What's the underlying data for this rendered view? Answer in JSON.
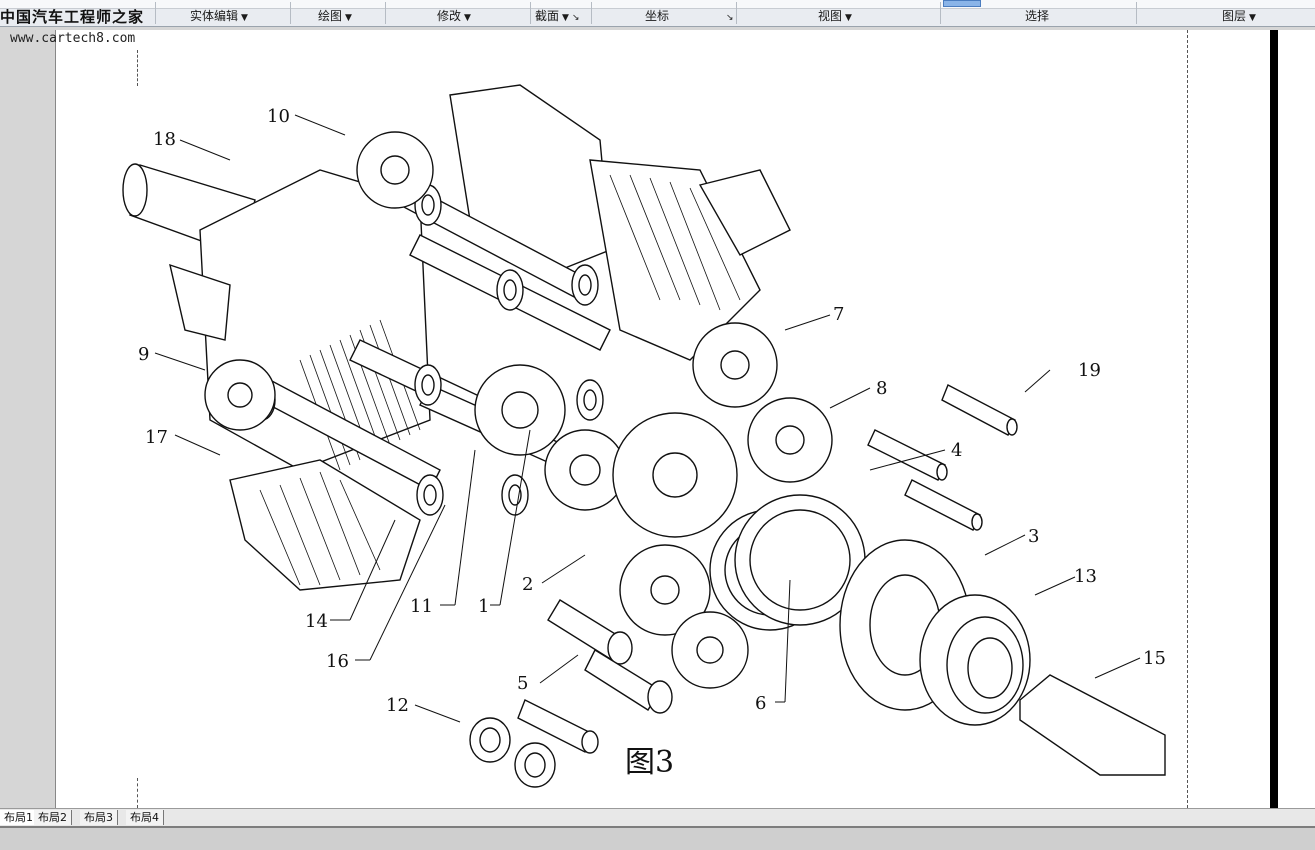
{
  "watermark": {
    "logo": "中国汽车工程师之家",
    "url": "www.cartech8.com"
  },
  "ribbon": {
    "panels": [
      {
        "label": "实体编辑"
      },
      {
        "label": "绘图"
      },
      {
        "label": "修改"
      },
      {
        "label": "截面"
      },
      {
        "label": "坐标"
      },
      {
        "label": "视图"
      },
      {
        "label": "选择"
      },
      {
        "label": "图层"
      }
    ]
  },
  "drawing": {
    "figure_caption": "图3",
    "callouts": [
      "1",
      "2",
      "3",
      "4",
      "5",
      "6",
      "7",
      "8",
      "9",
      "10",
      "11",
      "12",
      "13",
      "14",
      "15",
      "16",
      "17",
      "18",
      "19"
    ]
  },
  "layout_tabs": [
    "布局1",
    "布局2",
    "布局3",
    "布局4"
  ]
}
